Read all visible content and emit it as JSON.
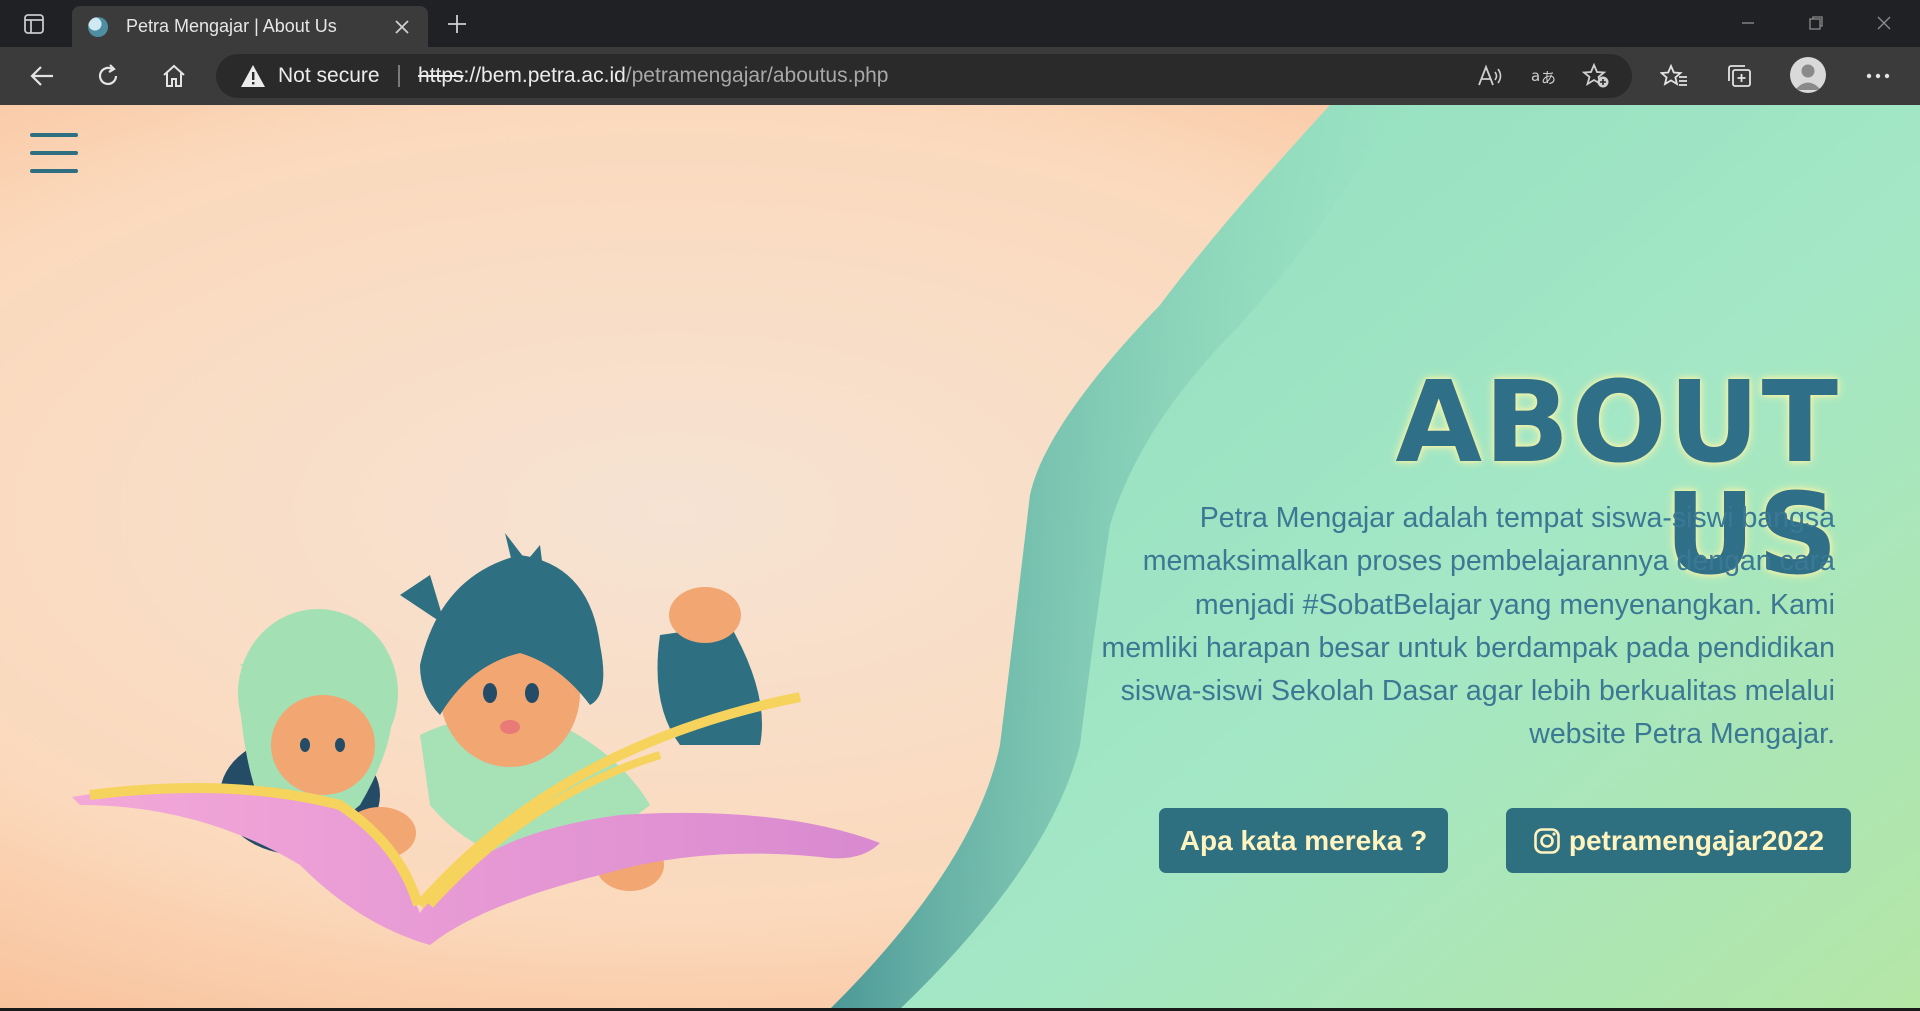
{
  "browser": {
    "tab": {
      "title": "Petra Mengajar | About Us",
      "favicon": "globe-icon"
    },
    "security_label": "Not secure",
    "url": {
      "scheme": "https",
      "separator": "://",
      "host": "bem.petra.ac.id",
      "path": "/petramengajar/aboutus.php"
    }
  },
  "page": {
    "title": "ABOUT US",
    "description": "Petra Mengajar adalah tempat siswa-siswi bangsa memaksimalkan proses pembelajarannya dengan cara menjadi #SobatBelajar yang menyenangkan. Kami memliki harapan besar untuk berdampak pada pendidikan siswa-siswi Sekolah Dasar agar lebih berkualitas melalui website Petra Mengajar.",
    "buttons": {
      "opinion": "Apa kata mereka ?",
      "instagram": "petramengajar2022"
    },
    "illustration": "children-reading-book",
    "colors": {
      "accent": "#2e6f80",
      "button_text": "#fff3c0",
      "peach_background": "#fae0c7",
      "mint_background": "#a9e6c2",
      "title": "#2f7088"
    }
  }
}
